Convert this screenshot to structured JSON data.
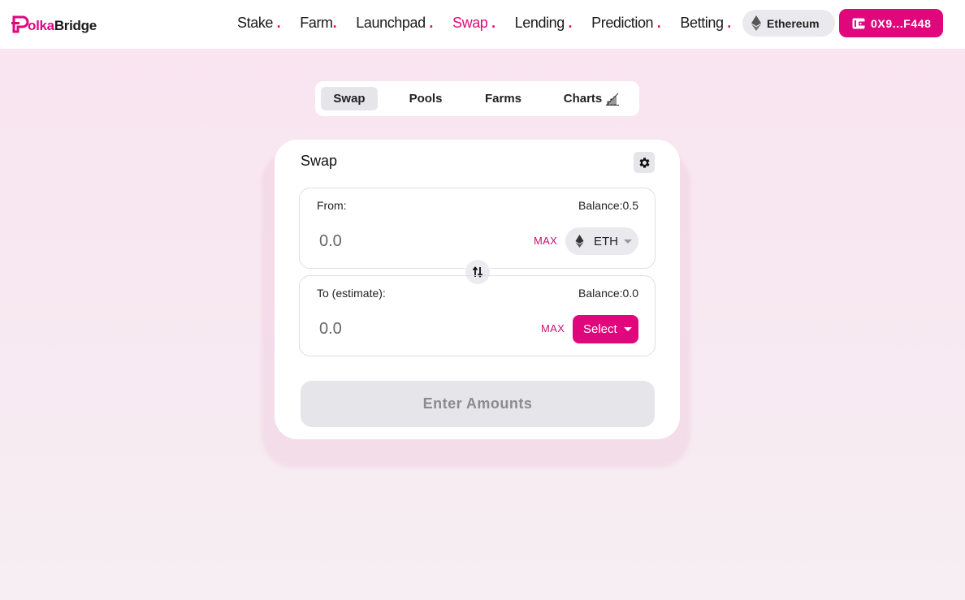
{
  "brand": {
    "logo_prefix": "olka",
    "logo_suffix": "Bridge",
    "accent": "#e0077d"
  },
  "nav": {
    "items": [
      {
        "label": "Stake",
        "dot": ".",
        "active": false
      },
      {
        "label": "Farm",
        "dot": ".",
        "active": false
      },
      {
        "label": "Launchpad",
        "dot": ".",
        "active": false
      },
      {
        "label": "Swap",
        "dot": ".",
        "active": true
      },
      {
        "label": "Lending",
        "dot": ".",
        "active": false
      },
      {
        "label": "Prediction",
        "dot": ".",
        "active": false
      },
      {
        "label": "Betting",
        "dot": ".",
        "active": false
      }
    ],
    "network_label": "Ethereum",
    "wallet_label": "0X9...F448"
  },
  "tabs": [
    {
      "label": "Swap",
      "active": true
    },
    {
      "label": "Pools",
      "active": false
    },
    {
      "label": "Farms",
      "active": false
    },
    {
      "label": "Charts",
      "active": false
    }
  ],
  "swap": {
    "title": "Swap",
    "from": {
      "label": "From:",
      "balance": "Balance:0.5",
      "placeholder": "0.0",
      "max_label": "MAX",
      "token": "ETH"
    },
    "to": {
      "label": "To (estimate):",
      "balance": "Balance:0.0",
      "placeholder": "0.0",
      "max_label": "MAX",
      "token": "Select"
    },
    "submit_label": "Enter Amounts"
  }
}
